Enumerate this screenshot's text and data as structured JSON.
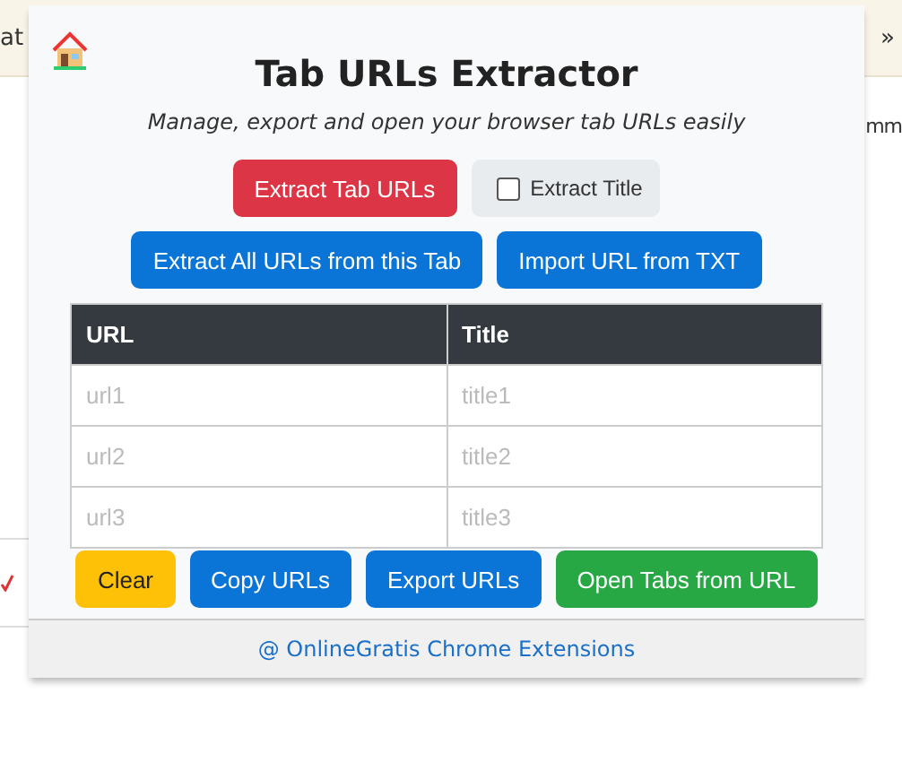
{
  "background": {
    "bookmark_left": "at",
    "bookmark_overflow": "»",
    "page_text": "mm"
  },
  "popup": {
    "title": "Tab URLs Extractor",
    "subtitle": "Manage, export and open your browser tab URLs easily",
    "row1": [
      {
        "kind": "danger",
        "label": "Extract Tab URLs"
      },
      {
        "kind": "checkbox",
        "label": "Extract Title",
        "checked": false
      }
    ],
    "row2": [
      {
        "kind": "primary",
        "label": "Extract All URLs from this Tab"
      },
      {
        "kind": "primary",
        "label": "Import URL from TXT"
      }
    ],
    "table": {
      "columns": [
        "URL",
        "Title"
      ],
      "rows": [
        [
          "url1",
          "title1"
        ],
        [
          "url2",
          "title2"
        ],
        [
          "url3",
          "title3"
        ]
      ]
    },
    "actions": [
      {
        "kind": "warning",
        "label": "Clear"
      },
      {
        "kind": "primary",
        "label": "Copy URLs"
      },
      {
        "kind": "primary",
        "label": "Export URLs"
      },
      {
        "kind": "success",
        "label": "Open Tabs from URL"
      }
    ],
    "footer": "@ OnlineGratis Chrome Extensions"
  }
}
